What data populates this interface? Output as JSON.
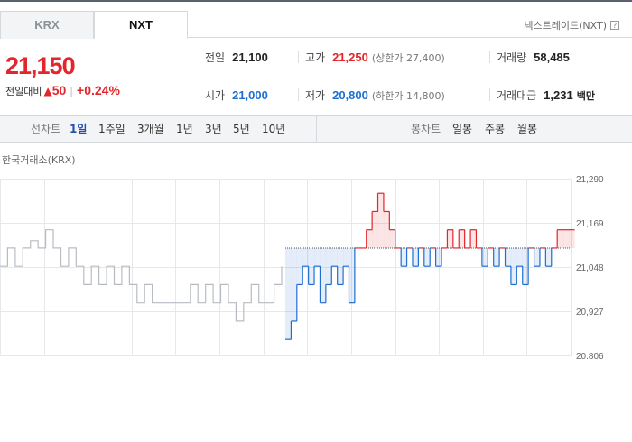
{
  "tabs": [
    {
      "label": "KRX"
    },
    {
      "label": "NXT"
    }
  ],
  "exchange_label": "넥스트레이드(NXT)",
  "help_icon": "?",
  "price": {
    "current": "21,150",
    "change_label": "전일대비",
    "arrow": "▲",
    "change": "50",
    "percent": "+0.24%"
  },
  "stats": {
    "prev_close": {
      "label": "전일",
      "value": "21,100"
    },
    "open": {
      "label": "시가",
      "value": "21,000"
    },
    "high": {
      "label": "고가",
      "value": "21,250",
      "sub": "(상한가 27,400)"
    },
    "low": {
      "label": "저가",
      "value": "20,800",
      "sub": "(하한가 14,800)"
    },
    "volume": {
      "label": "거래량",
      "value": "58,485"
    },
    "amount": {
      "label": "거래대금",
      "value": "1,231",
      "unit": "백만"
    }
  },
  "toolbar": {
    "line_chart_label": "선차트",
    "periods": [
      "1일",
      "1주일",
      "3개월",
      "1년",
      "3년",
      "5년",
      "10년"
    ],
    "active_period": "1일",
    "candle_label": "봉차트",
    "candle_periods": [
      "일봉",
      "주봉",
      "월봉"
    ]
  },
  "chart_title": "한국거래소(KRX)",
  "colors": {
    "up": "#e2262b",
    "down": "#1f6fd1",
    "krx_line": "#b8bcc2",
    "grid": "#e6e8eb"
  },
  "chart_data": {
    "type": "line",
    "title": "",
    "reference": 21100,
    "ylim": [
      20806,
      21290
    ],
    "yticks": [
      "21,290",
      "21,169",
      "21,048",
      "20,927",
      "20,806"
    ],
    "ytick_values": [
      21290,
      21169,
      21048,
      20927,
      20806
    ],
    "grid": true,
    "series": [
      {
        "values": [
          21050,
          21100,
          21050,
          21100,
          21120,
          21100,
          21150,
          21100,
          21050,
          21100,
          21050,
          21000,
          21050,
          21000,
          21050,
          21000,
          21050,
          21000,
          20950,
          21000,
          20950,
          20950,
          20950,
          20950,
          20950,
          21000,
          20950,
          21000,
          20950,
          21000,
          20950,
          20900,
          20950,
          21000,
          20950,
          20950,
          21000,
          21050
        ]
      },
      {
        "values": [
          20850,
          20900,
          21000,
          21050,
          21000,
          21050,
          20950,
          21000,
          21050,
          21000,
          21050,
          20950,
          21100,
          21100,
          21150,
          21200,
          21250,
          21200,
          21150,
          21100,
          21050,
          21100,
          21050,
          21100,
          21050,
          21100,
          21050,
          21100,
          21150,
          21100,
          21150,
          21100,
          21150,
          21100,
          21050,
          21100,
          21050,
          21100,
          21050,
          21000,
          21050,
          21000,
          21100,
          21050,
          21100,
          21050,
          21100,
          21150,
          21150,
          21150
        ]
      }
    ]
  }
}
